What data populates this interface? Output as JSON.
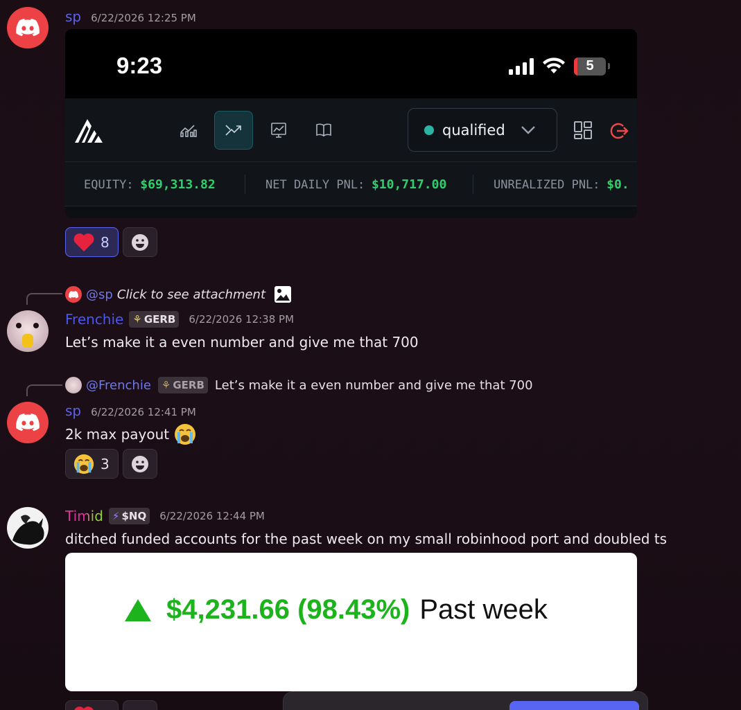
{
  "messages": {
    "m1": {
      "author": "sp",
      "time": "6/22/2026 12:25 PM",
      "attachment": {
        "status_time": "9:23",
        "battery": "5",
        "account_select": "qualified",
        "stats": [
          {
            "label": "EQUITY:",
            "value": "$69,313.82"
          },
          {
            "label": "NET DAILY PNL:",
            "value": "$10,717.00"
          },
          {
            "label": "UNREALIZED PNL:",
            "value": "$0."
          }
        ]
      },
      "reaction": {
        "emoji": "heart",
        "count": "8"
      }
    },
    "m2": {
      "reply_mention": "@sp",
      "reply_text": "Click to see attachment",
      "author": "Frenchie",
      "badge": "GERB",
      "time": "6/22/2026 12:38 PM",
      "text": "Let’s make it a even number and give me that 700"
    },
    "m3": {
      "reply_mention": "@Frenchie",
      "reply_badge": "GERB",
      "reply_text": "Let’s make it a even number and give me that 700",
      "author": "sp",
      "time": "6/22/2026 12:41 PM",
      "text": "2k max payout",
      "reaction": {
        "emoji": "loudly-crying",
        "count": "3"
      }
    },
    "m4": {
      "author": "Timid",
      "badge": "$NQ",
      "time": "6/22/2026 12:44 PM",
      "text": "ditched funded accounts for the past week on my small robinhood port and doubled ts",
      "attachment": {
        "gain": "$4,231.66 (98.43%)",
        "period": "Past week"
      }
    }
  },
  "colors": {
    "discord_red": "#ed4245",
    "blurple": "#5865f2",
    "gain_green": "#2ecf6c",
    "rh_green": "#1db31d"
  }
}
